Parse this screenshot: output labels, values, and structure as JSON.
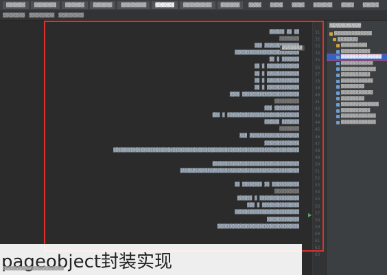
{
  "tabs": [
    "▓▓▓▓▓▓",
    "▓▓▓▓▓▓▓",
    "▓▓▓▓▓▓",
    "▓▓▓▓▓▓",
    "▓▓▓▓▓▓▓▓",
    "▓▓▓▓▓▓",
    "▓▓▓▓▓▓▓▓▓",
    "▓▓▓▓▓▓"
  ],
  "menu": [
    "▓▓▓▓",
    "▓▓▓▓",
    "▓▓▓▓",
    "▓▓▓▓▓▓",
    "▓▓▓▓",
    "▓▓▓▓▓",
    "▓▓▓▓"
  ],
  "breadcrumb": [
    "▓▓▓▓▓▓▓",
    "▓▓▓▓▓▓▓▓",
    "▓▓▓▓▓▓▓▓"
  ],
  "editor": {
    "hint": "▓▓▓▓▓▓▓",
    "lines": [
      {
        "n": "31",
        "t": "▓▓▓▓▓▓ ▓▓ ▓▓"
      },
      {
        "n": "32",
        "t": "▓▓▓▓▓▓▓▓",
        "c": true
      },
      {
        "n": "33",
        "t": "▓▓▓ ▓▓▓▓▓▓▓▓▓▓▓▓▓▓"
      },
      {
        "n": "34",
        "t": "▓▓▓▓▓▓▓▓▓▓▓▓▓▓▓▓▓▓▓▓▓▓▓▓▓▓"
      },
      {
        "n": "35",
        "t": "▓▓ ▓ ▓▓▓▓▓▓▓"
      },
      {
        "n": "36",
        "t": "▓▓ ▓ ▓▓▓▓▓▓▓▓▓▓▓▓▓"
      },
      {
        "n": "37",
        "t": "▓▓ ▓ ▓▓▓▓▓▓▓▓▓▓▓▓▓"
      },
      {
        "n": "38",
        "t": "▓▓ ▓ ▓▓▓▓▓▓▓▓▓▓▓▓▓"
      },
      {
        "n": "39",
        "t": "▓▓ ▓ ▓▓▓▓▓▓▓▓▓▓▓▓▓"
      },
      {
        "n": "40",
        "t": "▓▓▓▓ ▓▓▓▓▓▓▓▓▓▓▓▓▓▓▓▓▓▓▓▓▓▓▓"
      },
      {
        "n": "41",
        "t": "▓▓▓▓▓▓▓▓▓▓",
        "c": true
      },
      {
        "n": "42",
        "t": "▓▓▓ ▓▓▓▓▓▓▓▓▓▓"
      },
      {
        "n": "43",
        "t": "▓▓▓ ▓ ▓▓▓▓▓▓▓▓▓▓▓▓▓▓▓▓▓▓▓▓▓▓▓▓▓▓▓▓▓"
      },
      {
        "n": "44",
        "t": "▓▓▓▓▓▓ ▓▓▓▓▓▓▓"
      },
      {
        "n": "45",
        "t": "▓▓▓▓▓▓▓▓",
        "c": true
      },
      {
        "n": "46",
        "t": "▓▓▓ ▓▓▓▓▓▓▓▓▓▓▓▓▓▓▓▓▓▓▓▓"
      },
      {
        "n": "47",
        "t": "▓▓▓▓▓▓▓▓▓▓▓▓▓▓"
      },
      {
        "n": "48",
        "t": "▓▓▓▓▓▓▓▓▓▓▓▓▓▓▓▓▓▓▓▓▓▓▓▓▓▓▓▓▓▓▓▓▓▓▓▓▓▓▓▓▓▓▓▓▓▓▓▓▓▓▓▓▓▓▓▓▓▓▓▓▓▓▓▓▓▓▓▓▓▓▓▓▓▓▓"
      },
      {
        "n": "49",
        "t": ""
      },
      {
        "n": "50",
        "t": "▓▓▓▓▓▓▓▓▓▓▓▓▓▓▓▓▓▓▓▓▓▓▓▓▓▓▓▓▓▓▓▓▓▓▓"
      },
      {
        "n": "51",
        "t": "▓▓▓▓▓▓▓▓▓▓▓▓▓▓▓▓▓▓▓▓▓▓▓▓▓▓▓▓▓▓▓▓▓▓▓▓▓▓▓▓▓▓▓▓▓▓▓▓"
      },
      {
        "n": "52",
        "t": ""
      },
      {
        "n": "53",
        "t": "▓▓ ▓▓▓▓▓▓▓▓ ▓▓ ▓▓▓▓▓▓▓▓▓▓▓"
      },
      {
        "n": "54",
        "t": "▓▓▓▓▓▓▓▓▓▓",
        "c": true
      },
      {
        "n": "55",
        "t": "▓▓▓▓▓▓ ▓ ▓▓▓▓▓▓▓▓▓▓▓▓▓▓▓▓"
      },
      {
        "n": "56",
        "t": "▓▓▓ ▓ ▓▓▓▓▓▓▓▓▓▓▓▓▓▓▓"
      },
      {
        "n": "57",
        "t": "▓▓▓▓▓▓▓▓▓▓▓▓▓▓▓▓▓▓▓▓▓▓▓▓▓▓"
      },
      {
        "n": "58",
        "t": "▓▓▓▓▓▓▓▓▓▓▓▓▓"
      },
      {
        "n": "59",
        "t": "▓▓▓▓▓▓▓▓▓▓▓▓▓▓▓▓▓▓▓▓▓▓▓▓▓▓▓▓▓▓▓▓▓"
      },
      {
        "n": "60",
        "t": ""
      },
      {
        "n": "61",
        "t": ""
      },
      {
        "n": "62",
        "t": ""
      },
      {
        "n": "63",
        "t": ""
      }
    ]
  },
  "project": {
    "title": "▓▓▓▓▓▓▓▓▓▓",
    "items": [
      {
        "label": "▓▓▓▓▓▓▓▓▓▓▓▓▓",
        "folder": true,
        "indent": 0
      },
      {
        "label": "▓▓▓▓▓▓▓",
        "folder": true,
        "indent": 1
      },
      {
        "label": "▓▓▓▓▓▓▓▓▓",
        "folder": true,
        "indent": 2
      },
      {
        "label": "▓▓▓▓▓▓▓▓▓▓",
        "folder": false,
        "indent": 2
      },
      {
        "label": "▓▓▓▓▓▓▓▓▓▓▓▓▓▓",
        "folder": false,
        "indent": 2,
        "selected": true
      },
      {
        "label": "▓▓▓▓▓▓▓▓▓▓▓",
        "folder": false,
        "indent": 2
      },
      {
        "label": "▓▓▓▓▓▓▓▓▓▓▓▓",
        "folder": false,
        "indent": 2
      },
      {
        "label": "▓▓▓▓▓▓▓▓▓▓",
        "folder": false,
        "indent": 2
      },
      {
        "label": "▓▓▓▓▓▓▓▓▓▓▓",
        "folder": false,
        "indent": 2
      },
      {
        "label": "▓▓▓▓▓▓▓▓",
        "folder": false,
        "indent": 2
      },
      {
        "label": "▓▓▓▓▓▓▓▓▓▓▓",
        "folder": false,
        "indent": 2
      },
      {
        "label": "▓▓▓▓▓▓▓▓",
        "folder": false,
        "indent": 2
      },
      {
        "label": "▓▓▓▓▓▓▓▓▓▓▓▓▓",
        "folder": false,
        "indent": 2
      },
      {
        "label": "▓▓▓▓▓▓▓▓▓▓",
        "folder": false,
        "indent": 2
      },
      {
        "label": "▓▓▓▓▓▓▓▓▓▓▓▓",
        "folder": false,
        "indent": 2
      },
      {
        "label": "▓▓▓▓▓▓▓▓▓▓▓▓",
        "folder": false,
        "indent": 2
      }
    ]
  },
  "overlay_title": "pageobject封装实现",
  "watermark": "▓▓▓▓▓▓▓▓▓▓▓▓▓▓▓▓▓▓▓▓▓",
  "colors": {
    "highlight": "#e0312f",
    "selection": "#2f65ca"
  }
}
